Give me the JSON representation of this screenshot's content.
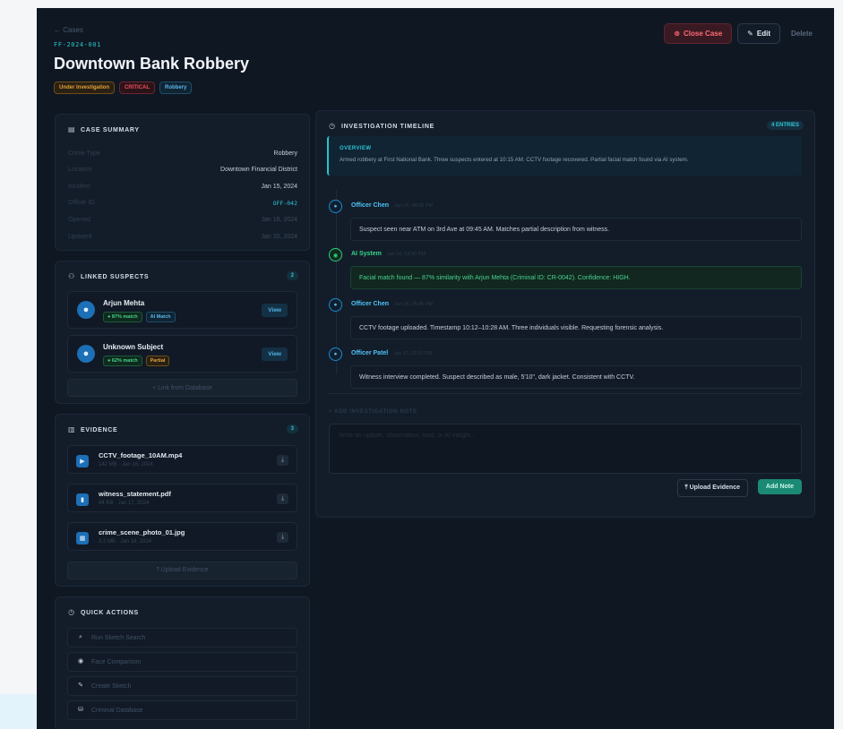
{
  "header": {
    "back_label": "← Cases",
    "case_id": "FF-2024-001",
    "title": "Downtown Bank Robbery",
    "tags": [
      "Under Investigation",
      "CRITICAL",
      "Robbery"
    ],
    "close_case_label": "Close Case",
    "edit_label": "Edit",
    "delete_label": "Delete"
  },
  "summary": {
    "title": "CASE SUMMARY",
    "rows": [
      {
        "key": "Crime Type",
        "value": "Robbery"
      },
      {
        "key": "Location",
        "value": "Downtown Financial District"
      },
      {
        "key": "Incident",
        "value": "Jan 15, 2024"
      },
      {
        "key": "Officer ID",
        "value": "OFF-042"
      },
      {
        "key": "Opened",
        "value": "Jan 16, 2024"
      },
      {
        "key": "Updated",
        "value": "Jan 20, 2024"
      }
    ]
  },
  "suspects": {
    "title": "LINKED SUSPECTS",
    "count": "2",
    "items": [
      {
        "name": "Arjun Mehta",
        "match": "● 87% match",
        "tag": "AI Match",
        "view": "View"
      },
      {
        "name": "Unknown Subject",
        "match": "● 62% match",
        "tag": "Partial",
        "view": "View"
      }
    ],
    "link_label": "+ Link from Database"
  },
  "evidence": {
    "title": "EVIDENCE",
    "count": "3",
    "items": [
      {
        "name": "CCTV_footage_10AM.mp4",
        "meta": "142 MB · Jan 16, 2024"
      },
      {
        "name": "witness_statement.pdf",
        "meta": "84 KB · Jan 17, 2024"
      },
      {
        "name": "crime_scene_photo_01.jpg",
        "meta": "3.2 MB · Jan 16, 2024"
      }
    ],
    "upload_label": "⤒ Upload Evidence"
  },
  "quick_actions": {
    "title": "QUICK ACTIONS",
    "items": [
      "Run Sketch Search",
      "Face Comparison",
      "Create Sketch",
      "Criminal Database"
    ]
  },
  "timeline": {
    "title": "INVESTIGATION TIMELINE",
    "count": "4 ENTRIES",
    "overview_title": "OVERVIEW",
    "overview_text": "Armed robbery at First National Bank. Three suspects entered at 10:15 AM. CCTV footage recovered. Partial facial match found via AI system.",
    "entries": [
      {
        "who": "Officer Chen",
        "time": "Jan 16, 04:00 PM",
        "text": "Suspect seen near ATM on 3rd Ave at 09:45 AM. Matches partial description from witness."
      },
      {
        "who": "AI System",
        "time": "Jan 16, 04:30 PM",
        "text": "Facial match found — 87% similarity with Arjun Mehta (Criminal ID: CR-0042). Confidence: HIGH."
      },
      {
        "who": "Officer Chen",
        "time": "Jan 16, 05:45 PM",
        "text": "CCTV footage uploaded. Timestamp 10:12–10:28 AM. Three individuals visible. Requesting forensic analysis."
      },
      {
        "who": "Officer Patel",
        "time": "Jan 17, 02:30 PM",
        "text": "Witness interview completed. Suspect described as male, 5'10\", dark jacket. Consistent with CCTV."
      }
    ],
    "add_note_title": "+ ADD INVESTIGATION NOTE",
    "note_placeholder": "Write an update, observation, lead, or AI insight...",
    "upload_label": "⤒ Upload Evidence",
    "add_note_label": "Add Note"
  },
  "colors": {
    "background": "#0f1722",
    "panel": "#131d2a",
    "accent_cyan": "#26c6c6",
    "accent_blue": "#4fc3f7",
    "danger": "#ef4d5b",
    "success": "#35d58a",
    "warning": "#e0a23c"
  }
}
